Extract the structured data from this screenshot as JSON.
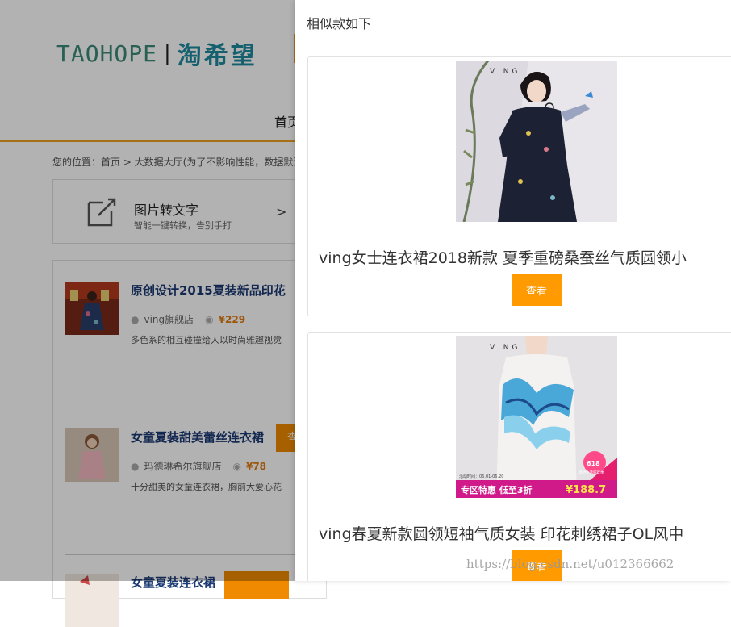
{
  "background": {
    "logo_en": "TAOHOPE",
    "logo_sep": "|",
    "logo_cn": "淘希望",
    "nav_first": "首页",
    "breadcrumb": "您的位置：首页 > 大数据大厅(为了不影响性能，数据默认",
    "tool": {
      "title": "图片转文字",
      "subtitle": "智能一键转换，告别手打",
      "arrow": ">"
    },
    "items": [
      {
        "title": "原创设计2015夏装新品印花",
        "shop": "ving旗舰店",
        "price": "¥229",
        "desc": "多色系的相互碰撞给人以时尚雅趣视觉"
      },
      {
        "title": "女童夏装甜美蕾丝连衣裙",
        "shop": "玛德琳希尔旗舰店",
        "price": "¥78",
        "desc": "十分甜美的女童连衣裙，胸前大爱心花",
        "button": "查"
      },
      {
        "title": "女童夏装连衣裙"
      }
    ]
  },
  "panel": {
    "title": "相似款如下",
    "cards": [
      {
        "brand": "VING",
        "title": "ving女士连衣裙2018新款 夏季重磅桑蚕丝气质圆领小",
        "button": "查看"
      },
      {
        "brand": "VING",
        "title": "ving春夏新款圆领短袖气质女装 印花刺绣裙子OL风中",
        "button": "查看",
        "promo": {
          "badge": "618",
          "badge_sub": "理想生活狂欢季",
          "date": "活动时间：06.01-06.20",
          "tag": "专区特惠 低至3折",
          "price": "¥188.7"
        }
      }
    ]
  },
  "watermark": "https://blog.csdn.net/u012366662",
  "colors": {
    "accent": "#ff9a00",
    "title_blue": "#1c3a74",
    "nav_line": "#f0a020"
  }
}
